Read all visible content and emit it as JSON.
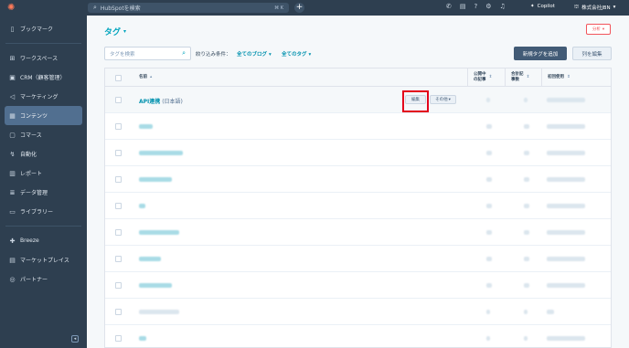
{
  "topbar": {
    "search_placeholder": "HubSpotを検索",
    "shortcut": "⌘ K",
    "copilot": "Copilot",
    "company": "株式会社JBN"
  },
  "sidebar": {
    "items": [
      {
        "label": "ブックマーク",
        "icon": "bookmark-icon"
      },
      {
        "label": "ワークスペース",
        "icon": "grid-icon"
      },
      {
        "label": "CRM（顧客管理）",
        "icon": "contacts-icon"
      },
      {
        "label": "マーケティング",
        "icon": "megaphone-icon"
      },
      {
        "label": "コンテンツ",
        "icon": "content-icon"
      },
      {
        "label": "コマース",
        "icon": "commerce-icon"
      },
      {
        "label": "自動化",
        "icon": "automation-icon"
      },
      {
        "label": "レポート",
        "icon": "chart-icon"
      },
      {
        "label": "データ管理",
        "icon": "database-icon"
      },
      {
        "label": "ライブラリー",
        "icon": "folder-icon"
      },
      {
        "label": "Breeze",
        "icon": "breeze-icon"
      },
      {
        "label": "マーケットプレイス",
        "icon": "store-icon"
      },
      {
        "label": "パートナー",
        "icon": "partner-icon"
      }
    ]
  },
  "page": {
    "title": "タグ",
    "analysis_button": "分析"
  },
  "filters": {
    "search_placeholder": "タグを検索",
    "label": "絞り込み条件：",
    "blog_dropdown": "全てのブログ",
    "tag_dropdown": "全てのタグ",
    "add_button": "新規タグを追加",
    "edit_columns_button": "列を編集"
  },
  "table": {
    "headers": {
      "name": "名前",
      "published_1": "公開中",
      "published_2": "の記事",
      "total_1": "合計記",
      "total_2": "事数",
      "first_used": "初回使用"
    },
    "first_row": {
      "name": "API連携",
      "lang": "(日本語)",
      "edit": "編集",
      "other": "その他"
    }
  },
  "colors": {
    "accent": "#00a4bd",
    "nav": "#2e3f50",
    "highlight": "#e3001b"
  }
}
